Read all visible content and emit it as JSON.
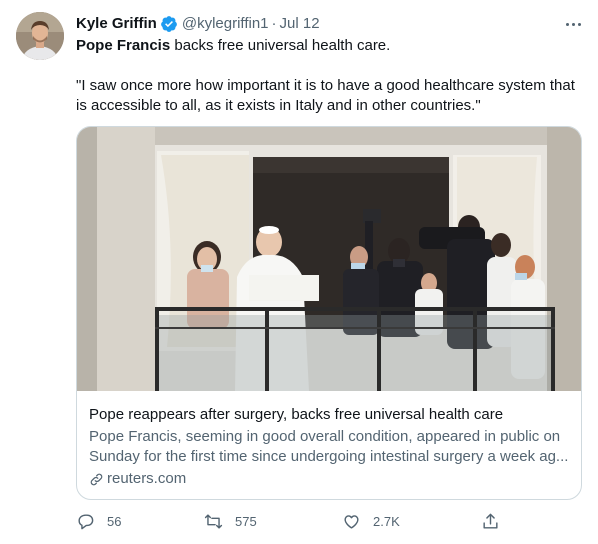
{
  "tweet": {
    "author": {
      "display_name": "Kyle Griffin",
      "handle": "@kylegriffin1",
      "verified": true,
      "avatar_icon": "profile-photo"
    },
    "separator": "·",
    "timestamp": "Jul 12",
    "text": {
      "bold_lead": "Pope Francis",
      "lead_rest": " backs free universal health care.",
      "quote": "\"I saw once more how important it is to have a good healthcare system that is accessible to all, as it exists in Italy and in other countries.\""
    },
    "card": {
      "title": "Pope reappears after surgery, backs free universal health care",
      "description": "Pope Francis, seeming in good overall condition, appeared in public on Sunday for the first time since undergoing intestinal surgery a week ag...",
      "domain": "reuters.com",
      "link_icon": "link-icon"
    },
    "actions": {
      "reply_count": "56",
      "retweet_count": "575",
      "like_count": "2.7K"
    }
  },
  "colors": {
    "text_primary": "#0f1419",
    "text_secondary": "#536471",
    "verified_blue": "#1d9bf0",
    "border": "#cfd9de"
  }
}
